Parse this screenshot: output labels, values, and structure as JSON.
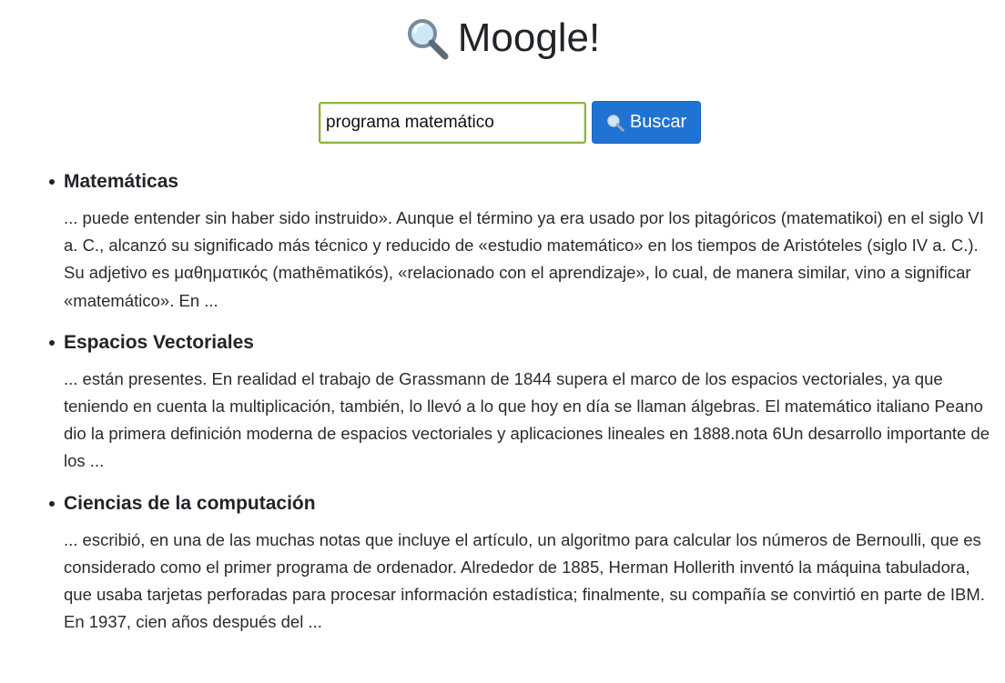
{
  "header": {
    "title": "Moogle!",
    "icon": "magnifier-icon"
  },
  "search": {
    "value": "programa matemático",
    "button_label": "Buscar",
    "button_icon": "magnifier-icon",
    "button_color": "#1f74d3"
  },
  "results": [
    {
      "title": "Matemáticas",
      "snippet": "... puede entender sin haber sido instruido». Aunque el término ya era usado por los pitagóricos (matematikoi) en el siglo VI a. C., alcanzó su significado más técnico y reducido de «estudio matemático» en los tiempos de Aristóteles (siglo IV a. C.). Su adjetivo es μαθηματικός (mathēmatikós), «relacionado con el aprendizaje», lo cual, de manera similar, vino a significar «matemático». En ..."
    },
    {
      "title": "Espacios Vectoriales",
      "snippet": "... están presentes. En realidad el trabajo de Grassmann de 1844 supera el marco de los espacios vectoriales, ya que teniendo en cuenta la multiplicación, también, lo llevó a lo que hoy en día se llaman álgebras. El matemático italiano Peano dio la primera definición moderna de espacios vectoriales y aplicaciones lineales en 1888.nota 6Un desarrollo importante de los ..."
    },
    {
      "title": "Ciencias de la computación",
      "snippet": "... escribió, en una de las muchas notas que incluye el artículo, un algoritmo para calcular los números de Bernoulli, que es considerado como el primer programa de ordenador. Alrededor de 1885, Herman Hollerith inventó la máquina tabuladora, que usaba tarjetas perforadas para procesar información estadística; finalmente, su compañía se convirtió en parte de IBM. En 1937, cien años después del ..."
    }
  ]
}
